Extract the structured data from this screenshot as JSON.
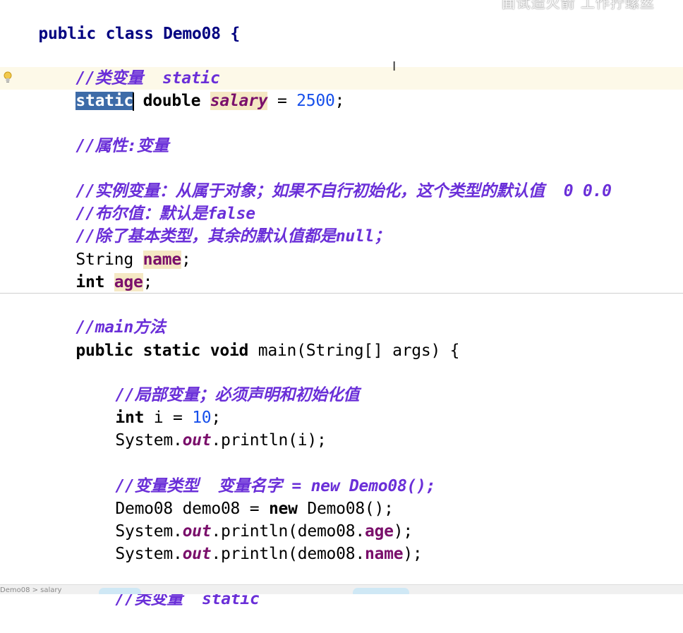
{
  "overlay_caption": "面试造火箭 工作拧螺丝",
  "status_breadcrumb": "Demo08 > salary",
  "code": {
    "class_decl": "public class Demo08 {",
    "c_class_var": "//类变量  static",
    "salary_kw1": "static",
    "salary_type": " double ",
    "salary_name": "salary",
    "salary_rest": " = ",
    "salary_value": "2500",
    "salary_end": ";",
    "c_attr": "//属性:变量",
    "c_instance": "//实例变量：从属于对象；如果不自行初始化，这个类型的默认值  0 0.0",
    "c_bool": "//布尔值：默认是false",
    "c_null": "//除了基本类型，其余的默认值都是null；",
    "name_type": "String ",
    "name_field": "name",
    "name_end": ";",
    "age_type": "int",
    "age_sp": " ",
    "age_field": "age",
    "age_end": ";",
    "c_main": "//main方法",
    "main_kw": "public static void",
    "main_rest": " main(String[] args) {",
    "c_local": "//局部变量；必须声明和初始化值",
    "i_type": "int",
    "i_rest": " i = ",
    "i_value": "10",
    "i_end": ";",
    "print1_a": "System.",
    "print1_out": "out",
    "print1_b": ".println(i);",
    "c_vartype": "//变量类型  变量名字 = new Demo08();",
    "obj_a": "Demo08 demo08 = ",
    "obj_new": "new",
    "obj_b": " Demo08();",
    "print2_a": "System.",
    "print2_out": "out",
    "print2_b": ".println(demo08.",
    "print2_field": "age",
    "print2_c": ");",
    "print3_a": "System.",
    "print3_out": "out",
    "print3_b": ".println(demo08.",
    "print3_field": "name",
    "print3_c": ");",
    "c_class_var2": "//类变量  static"
  }
}
